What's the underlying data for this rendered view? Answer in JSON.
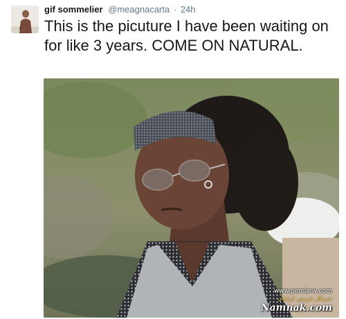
{
  "tweet": {
    "author": {
      "display_name": "gif sommelier",
      "handle": "@meagnacarta",
      "separator": "·",
      "timestamp": "24h"
    },
    "text": "This is the picuture I have been waiting on for like 3 years. COME ON NATURAL.",
    "media": {
      "watermark": {
        "url": "www.persianv.com",
        "subtitle": "خبرنگار تفریحی ایرانیان",
        "brand": "Namnak.com"
      }
    }
  }
}
